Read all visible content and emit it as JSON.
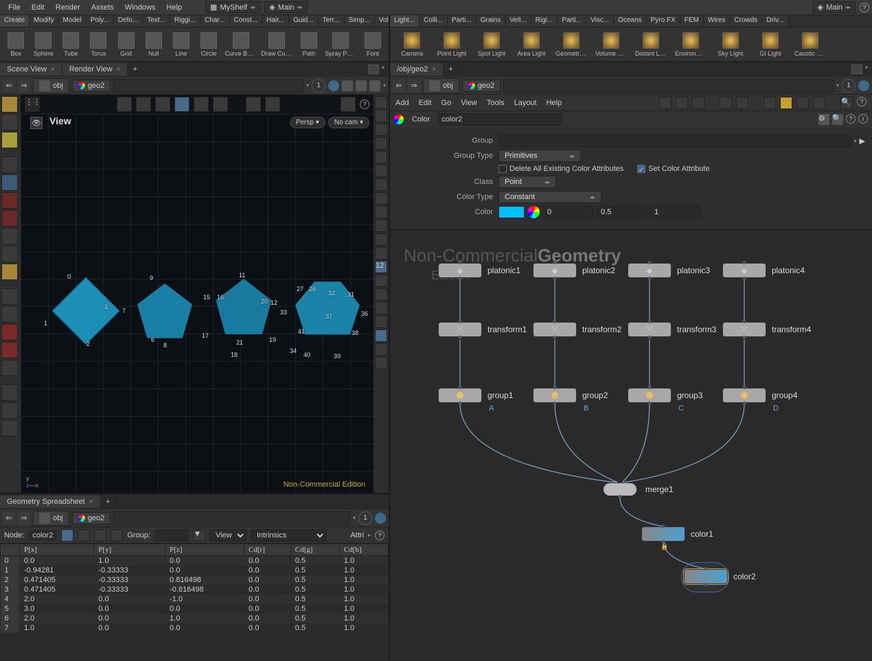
{
  "menus": [
    "File",
    "Edit",
    "Render",
    "Assets",
    "Windows",
    "Help"
  ],
  "desks": {
    "shelf": "MyShelf",
    "main": "Main",
    "panetab": "Main"
  },
  "shelf_tabs_left": [
    "Create",
    "Modify",
    "Model",
    "Poly...",
    "Defo...",
    "Text...",
    "Riggi...",
    "Char...",
    "Const...",
    "Hair...",
    "Guid...",
    "Terr...",
    "Simp...",
    "Volu..."
  ],
  "shelf_tabs_right": [
    "Light...",
    "Colli...",
    "Parti...",
    "Grains",
    "Vell...",
    "Rigi...",
    "Parti...",
    "Visc...",
    "Oceans",
    "Pyro FX",
    "FEM",
    "Wires",
    "Crowds",
    "Driv..."
  ],
  "shelf_tools_left": [
    {
      "n": "Box"
    },
    {
      "n": "Sphere"
    },
    {
      "n": "Tube"
    },
    {
      "n": "Torus"
    },
    {
      "n": "Grid"
    },
    {
      "n": "Null"
    },
    {
      "n": "Line"
    },
    {
      "n": "Circle"
    },
    {
      "n": "Curve Bezier"
    },
    {
      "n": "Draw Curve"
    },
    {
      "n": "Path"
    },
    {
      "n": "Spray Paint"
    },
    {
      "n": "Font"
    }
  ],
  "shelf_tools_right": [
    {
      "n": "Camera"
    },
    {
      "n": "Point Light"
    },
    {
      "n": "Spot Light"
    },
    {
      "n": "Area Light"
    },
    {
      "n": "Geometry Light"
    },
    {
      "n": "Volume Light"
    },
    {
      "n": "Distant Light"
    },
    {
      "n": "Environment Light"
    },
    {
      "n": "Sky Light"
    },
    {
      "n": "GI Light"
    },
    {
      "n": "Caustic Light"
    }
  ],
  "left_tabs": [
    {
      "t": "Scene View"
    },
    {
      "t": "Render View"
    }
  ],
  "right_tabs": [
    {
      "t": "/obj/geo2"
    }
  ],
  "path": {
    "a": "obj",
    "b": "geo2"
  },
  "viewport": {
    "title": "View",
    "persp": "Persp",
    "cam": "No cam",
    "watermark": "Non-Commercial Edition"
  },
  "point_labels": [
    "0",
    "9",
    "11",
    "27",
    "26",
    "32",
    "31",
    "3",
    "1",
    "7",
    "15",
    "16",
    "20",
    "12",
    "33",
    "37",
    "36",
    "6",
    "2",
    "8",
    "17",
    "21",
    "18",
    "19",
    "41",
    "34",
    "40",
    "39",
    "38"
  ],
  "gs": {
    "tab": "Geometry Spreadsheet",
    "node_label": "Node:",
    "node": "color2",
    "group_label": "Group:",
    "view": "View",
    "intr": "Intrinsics",
    "attr": "Attri"
  },
  "gs_cols": [
    "",
    "P[x]",
    "P[y]",
    "P[z]",
    "Cd[r]",
    "Cd[g]",
    "Cd[b]"
  ],
  "gs_rows": [
    [
      "0",
      "0.0",
      "1.0",
      "0.0",
      "0.0",
      "0.5",
      "1.0"
    ],
    [
      "1",
      "-0.94281",
      "-0.33333",
      "0.0",
      "0.0",
      "0.5",
      "1.0"
    ],
    [
      "2",
      "0.471405",
      "-0.33333",
      "0.816498",
      "0.0",
      "0.5",
      "1.0"
    ],
    [
      "3",
      "0.471405",
      "-0.33333",
      "-0.816498",
      "0.0",
      "0.5",
      "1.0"
    ],
    [
      "4",
      "2.0",
      "0.0",
      "-1.0",
      "0.0",
      "0.5",
      "1.0"
    ],
    [
      "5",
      "3.0",
      "0.0",
      "0.0",
      "0.0",
      "0.5",
      "1.0"
    ],
    [
      "6",
      "2.0",
      "0.0",
      "1.0",
      "0.0",
      "0.5",
      "1.0"
    ],
    [
      "7",
      "1.0",
      "0.0",
      "0.0",
      "0.0",
      "0.5",
      "1.0"
    ]
  ],
  "net_menu": [
    "Add",
    "Edit",
    "Go",
    "View",
    "Tools",
    "Layout",
    "Help"
  ],
  "parm": {
    "type": "Color",
    "name": "color2",
    "group_l": "Group",
    "group_v": "",
    "gtype_l": "Group Type",
    "gtype_v": "Primitives",
    "del_l": "Delete All Existing Color Attributes",
    "set_l": "Set Color Attribute",
    "class_l": "Class",
    "class_v": "Point",
    "ctype_l": "Color Type",
    "ctype_v": "Constant",
    "color_l": "Color",
    "c_r": "0",
    "c_g": "0.5",
    "c_b": "1"
  },
  "geo_wm": {
    "a": "Non-Commercial",
    "b": "Edition",
    "big": "Geometry"
  },
  "nodes": {
    "platonic": [
      "platonic1",
      "platonic2",
      "platonic3",
      "platonic4"
    ],
    "transform": [
      "transform1",
      "transform2",
      "transform3",
      "transform4"
    ],
    "group": [
      "group1",
      "group2",
      "group3",
      "group4"
    ],
    "group_sub": [
      "A",
      "B",
      "C",
      "D"
    ],
    "merge": "merge1",
    "color1": "color1",
    "color2": "color2"
  },
  "one": "1"
}
